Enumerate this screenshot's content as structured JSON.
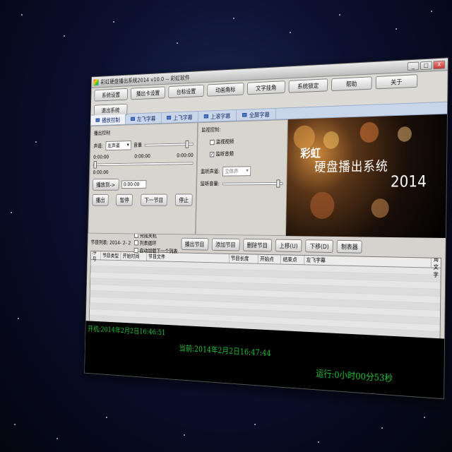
{
  "window": {
    "title": "彩虹硬盘播出系统2014 v10.0 -- 彩虹软件",
    "controls": [
      "_",
      "□",
      "X"
    ]
  },
  "menu": {
    "buttons": [
      "系统设置",
      "播出卡设置",
      "台标设置",
      "动画角标",
      "文字挂角",
      "系统锁定",
      "帮助",
      "关于",
      "退出系统"
    ]
  },
  "tabs": [
    "播放控制",
    "左飞字幕",
    "上飞字幕",
    "上滚字幕",
    "全屏字幕"
  ],
  "playback": {
    "title": "播出控制",
    "channel_label": "声道:",
    "channel_value": "左声道",
    "volume_label": "音量",
    "time_start": "0:00:00",
    "time_current": "0:00:00",
    "time_end": "0:00:00",
    "time_row2": "0:00:00",
    "seek_label": "播放到->",
    "seek_value": "0:00:00",
    "buttons": [
      "播出",
      "暂停",
      "下一节目",
      "停止"
    ],
    "volume_level": 0.85
  },
  "monitor": {
    "title": "监视控制:",
    "video_label": "监视视频",
    "video_checked": false,
    "audio_label": "监听音频",
    "audio_checked": true,
    "channel_label": "监听声道:",
    "channel_value": "立体声",
    "volume_label": "监听音量:",
    "volume_level": 0.9
  },
  "preview": {
    "line1": "彩虹",
    "line2": "硬盘播出系统",
    "line3": "2014"
  },
  "playlist": {
    "date_label": "节目列表: 2014- 2- 2",
    "options": [
      {
        "label": "完成关机",
        "checked": false
      },
      {
        "label": "列表循环",
        "checked": false
      },
      {
        "label": "自动加载下一个列表",
        "checked": false
      }
    ],
    "buttons": [
      "播出节目",
      "添加节目",
      "删除节目",
      "上移(U)",
      "下移(D)",
      "制表器"
    ],
    "columns": [
      "序号",
      "节目类型",
      "开始时间",
      "节目文件",
      "节目长度",
      "开始点",
      "结束点",
      "左飞字幕",
      "挂角文字"
    ]
  },
  "status": {
    "boot_time": "开机:2014年2月2日16:46:51",
    "current_time": "当前:2014年2月2日16:47:44",
    "run_time": "运行:0小时00分53秒"
  },
  "colors": {
    "status_text": "#23c23a",
    "tab_text": "#1a2f6b"
  }
}
